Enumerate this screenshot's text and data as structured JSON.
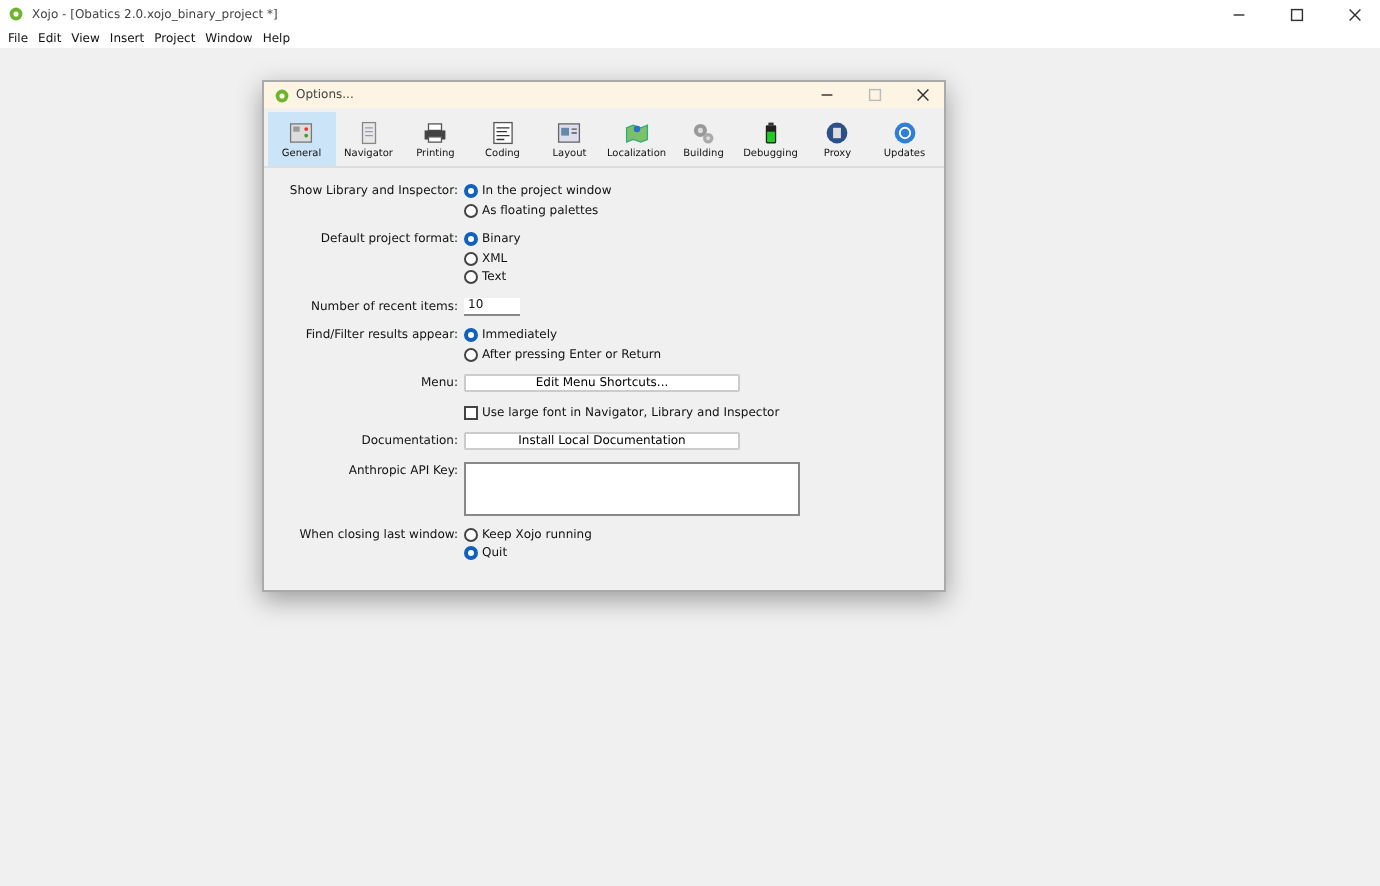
{
  "window": {
    "title": "Xojo - [Obatics 2.0.xojo_binary_project *]"
  },
  "menu": [
    "File",
    "Edit",
    "View",
    "Insert",
    "Project",
    "Window",
    "Help"
  ],
  "dialog": {
    "title": "Options...",
    "tabs": [
      {
        "label": "General",
        "selected": true
      },
      {
        "label": "Navigator",
        "selected": false
      },
      {
        "label": "Printing",
        "selected": false
      },
      {
        "label": "Coding",
        "selected": false
      },
      {
        "label": "Layout",
        "selected": false
      },
      {
        "label": "Localization",
        "selected": false
      },
      {
        "label": "Building",
        "selected": false
      },
      {
        "label": "Debugging",
        "selected": false
      },
      {
        "label": "Proxy",
        "selected": false
      },
      {
        "label": "Updates",
        "selected": false
      }
    ],
    "rows": [
      {
        "kind": "radios",
        "label": "Show Library and Inspector:",
        "options": [
          {
            "label": "In the project window",
            "selected": true
          },
          {
            "label": "As floating palettes",
            "selected": false
          }
        ]
      },
      {
        "kind": "radios",
        "label": "Default project format:",
        "options": [
          {
            "label": "Binary",
            "selected": true
          },
          {
            "label": "XML",
            "selected": false
          },
          {
            "label": "Text",
            "selected": false
          }
        ]
      },
      {
        "kind": "field",
        "label": "Number of recent items:",
        "value": "10"
      },
      {
        "kind": "radios",
        "label": "Find/Filter results appear:",
        "options": [
          {
            "label": "Immediately",
            "selected": true
          },
          {
            "label": "After pressing Enter or Return",
            "selected": false
          }
        ]
      },
      {
        "kind": "button",
        "label": "Menu:",
        "button": "Edit Menu Shortcuts..."
      },
      {
        "kind": "checkbox",
        "text": "Use large font in Navigator, Library and Inspector",
        "checked": false
      },
      {
        "kind": "button",
        "label": "Documentation:",
        "button": "Install Local Documentation"
      },
      {
        "kind": "textarea",
        "label": "Anthropic API Key:"
      },
      {
        "kind": "radios",
        "label": "When closing last window:",
        "options": [
          {
            "label": "Keep Xojo running",
            "selected": false
          },
          {
            "label": "Quit",
            "selected": true
          }
        ]
      }
    ]
  }
}
